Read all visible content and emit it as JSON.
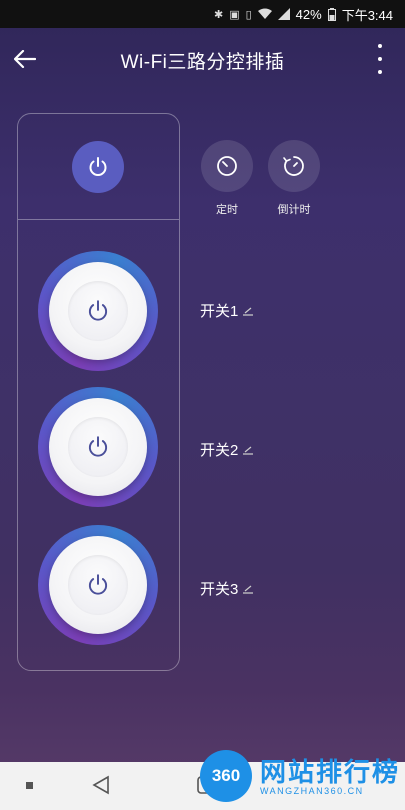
{
  "status_bar": {
    "battery": "42%",
    "time": "下午3:44",
    "icons": [
      "bluetooth-icon",
      "nfc-icon",
      "vibrate-icon",
      "wifi-icon",
      "signal-icon",
      "battery-icon"
    ]
  },
  "header": {
    "title": "Wi-Fi三路分控排插",
    "back_icon": "arrow-left-icon",
    "more_icon": "more-vertical-icon"
  },
  "master_switch": {
    "icon": "power-icon",
    "state": "on",
    "color": "#5a5dc0"
  },
  "timers": [
    {
      "label": "定时",
      "icon": "timer-icon"
    },
    {
      "label": "倒计时",
      "icon": "countdown-icon"
    }
  ],
  "switches": [
    {
      "label": "开关1",
      "icon": "power-icon",
      "edit_icon": "edit-icon"
    },
    {
      "label": "开关2",
      "icon": "power-icon",
      "edit_icon": "edit-icon"
    },
    {
      "label": "开关3",
      "icon": "power-icon",
      "edit_icon": "edit-icon"
    }
  ],
  "watermark": {
    "badge": "360",
    "title": "网站排行榜",
    "subtitle": "WANGZHAN360.CN"
  },
  "colors": {
    "background": "#3d2f6c",
    "accent": "#5a5dc0",
    "watermark": "#1e90e6"
  }
}
